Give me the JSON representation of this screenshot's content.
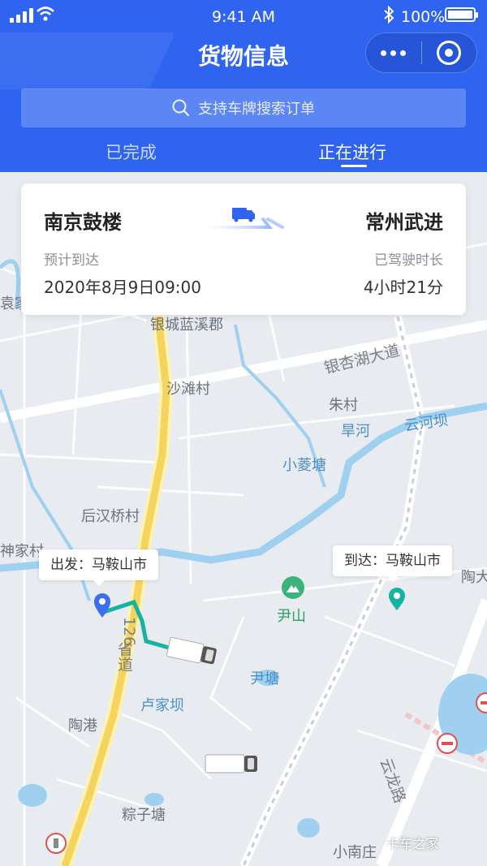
{
  "status_bar": {
    "time": "9:41 AM",
    "battery": "100%"
  },
  "header": {
    "title": "货物信息",
    "search_placeholder": "支持车牌搜索订单",
    "tabs": [
      {
        "label": "已完成",
        "active": false
      },
      {
        "label": "正在进行",
        "active": true
      }
    ]
  },
  "card": {
    "origin": "南京鼓楼",
    "destination": "常州武进",
    "eta_label": "预计到达",
    "eta_value": "2020年8月9日09:00",
    "duration_label": "已驾驶时长",
    "duration_value": "4小时21分"
  },
  "map": {
    "start_callout": "出发：马鞍山市",
    "end_callout": "到达：马鞍山市",
    "labels": {
      "yincheng": "银城蓝溪郡",
      "yinxinghu": "银杏湖大道",
      "shatan": "沙滩村",
      "zhucun": "朱村",
      "hanhe": "旱河",
      "yunhe": "云河坝",
      "xiaoling": "小菱塘",
      "houhan": "后汉桥村",
      "shenjia": "神家村",
      "yinshan": "尹山",
      "yintang": "尹塘",
      "lujiaba": "卢家坝",
      "taogang": "陶港",
      "zongzi": "粽子塘",
      "xiaonan": "小南庄",
      "yunlong": "云龙路",
      "yuan": "袁家",
      "shengdao": "省道",
      "road_no": "126",
      "daqiao": "陶大村"
    }
  },
  "watermark": "卡车之家",
  "colors": {
    "primary": "#2f64f0",
    "route": "#16b3a3",
    "start_pin": "#3c6ef0",
    "end_pin": "#16b3a3"
  }
}
